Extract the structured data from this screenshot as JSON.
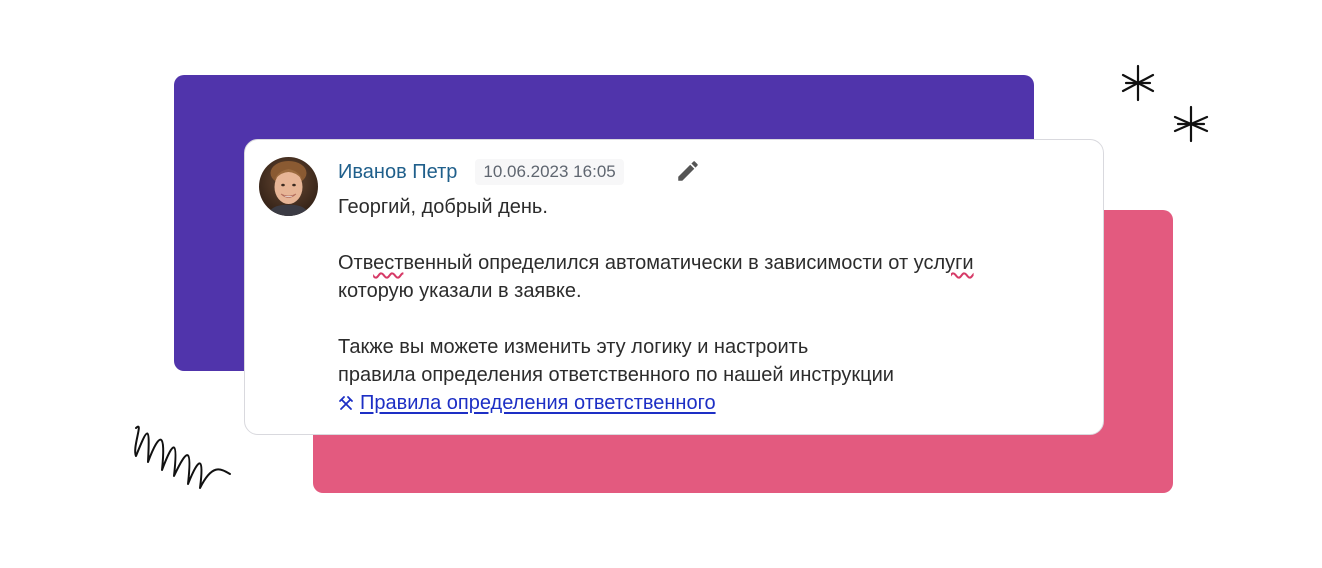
{
  "colors": {
    "purple_panel": "#5034ab",
    "pink_panel": "#e35a7f",
    "author": "#1f5f8b",
    "link": "#1d2fc5",
    "spell_mark": "#d63a67"
  },
  "comment": {
    "author": "Иванов Петр",
    "datetime": "10.06.2023 16:05",
    "edit_icon": "pencil-icon",
    "avatar_icon": "user-avatar",
    "greeting": "Георгий, добрый день.",
    "para1_line1_a": "Отв",
    "para1_line1_b": "ест",
    "para1_line1_c": "венный определился автоматически в зависимости от усл",
    "para1_line1_d": "уги",
    "para1_line2_a": "котор",
    "para1_line2_b": "ую указали в заявке.",
    "para2_line1": "Также вы можете изменить эту логику и настроить",
    "para2_line2": "правила определения ответственного по нашей инструкции",
    "link_icon": "hammer-pick-icon",
    "link_text": "Правила определения ответственного"
  }
}
